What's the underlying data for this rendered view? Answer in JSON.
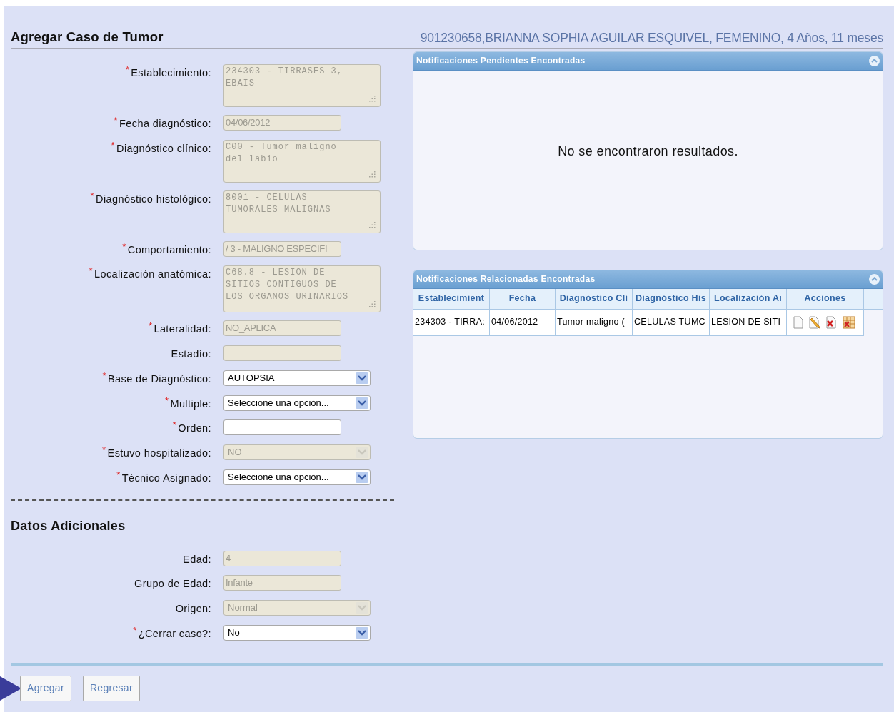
{
  "title": "Agregar Caso de Tumor",
  "patient": "901230658,BRIANNA SOPHIA AGUILAR ESQUIVEL, FEMENINO, 4 Años, 11 meses",
  "form": [
    {
      "label": "Establecimiento:",
      "required_mark": "*",
      "kind": "textarea",
      "value": "234303 - TIRRASES 3, EBAIS",
      "disabled": true
    },
    {
      "label": "Fecha diagnóstico:",
      "required_mark": "*",
      "kind": "text",
      "value": "04/06/2012",
      "disabled": true
    },
    {
      "label": "Diagnóstico clínico:",
      "required_mark": "*",
      "kind": "textarea",
      "value": "C00 - Tumor maligno del labio",
      "disabled": true
    },
    {
      "label": "Diagnóstico histológico:",
      "required_mark": "*",
      "kind": "textarea",
      "value": "8001 - CELULAS TUMORALES MALIGNAS",
      "disabled": true
    },
    {
      "label": "Comportamiento:",
      "required_mark": "*",
      "kind": "text",
      "value": "/ 3 - MALIGNO ESPECIFI",
      "disabled": true
    },
    {
      "label": "Localización anatómica:",
      "required_mark": "*",
      "kind": "textarea",
      "value": "C68.8 - LESION DE SITIOS CONTIGUOS DE LOS ORGANOS URINARIOS",
      "disabled": true
    },
    {
      "label": "Lateralidad:",
      "required_mark": "*",
      "kind": "text",
      "value": "NO_APLICA",
      "disabled": true
    },
    {
      "label": "Estadío:",
      "kind": "text",
      "disabled": true
    },
    {
      "label": "Base de Diagnóstico:",
      "required_mark": "*",
      "kind": "select",
      "value": "AUTOPSIA",
      "disabled": false
    },
    {
      "label": "Multiple:",
      "required_mark": "*",
      "kind": "select",
      "value": "Seleccione una opción...",
      "disabled": false
    },
    {
      "label": "Orden:",
      "required_mark": "*",
      "kind": "text",
      "disabled": false
    },
    {
      "label": "Estuvo hospitalizado:",
      "required_mark": "*",
      "kind": "select",
      "value": "NO",
      "disabled": true
    },
    {
      "label": "Técnico Asignado:",
      "required_mark": "*",
      "kind": "select",
      "value": "Seleccione una opción...",
      "disabled": false
    }
  ],
  "additional": {
    "title": "Datos Adicionales",
    "fields": [
      {
        "label": "Edad:",
        "kind": "text",
        "value": "4",
        "disabled": true
      },
      {
        "label": "Grupo de Edad:",
        "kind": "text",
        "value": "Infante",
        "disabled": true
      },
      {
        "label": "Origen:",
        "kind": "select",
        "value": "Normal",
        "disabled": true
      },
      {
        "label": "¿Cerrar caso?:",
        "required_mark": "*",
        "kind": "select",
        "value": "No",
        "disabled": false
      }
    ]
  },
  "pending_panel": {
    "title": "Notificaciones Pendientes Encontradas",
    "message": "No se encontraron resultados."
  },
  "related_panel": {
    "title": "Notificaciones Relacionadas Encontradas",
    "columns": [
      "Establecimient",
      "Fecha",
      "Diagnóstico Clí",
      "Diagnóstico His",
      "Localización Aı",
      "Acciones"
    ],
    "rows": [
      {
        "cells": [
          "234303 - TIRRA:",
          "04/06/2012",
          "Tumor maligno (",
          "CELULAS TUMC",
          "LESION DE SITI"
        ],
        "actions": [
          {
            "kind": "view"
          },
          {
            "kind": "edit"
          },
          {
            "kind": "delete"
          },
          {
            "kind": "grid"
          }
        ]
      }
    ]
  },
  "buttons": [
    {
      "label": "Agregar"
    },
    {
      "label": "Regresar"
    }
  ]
}
